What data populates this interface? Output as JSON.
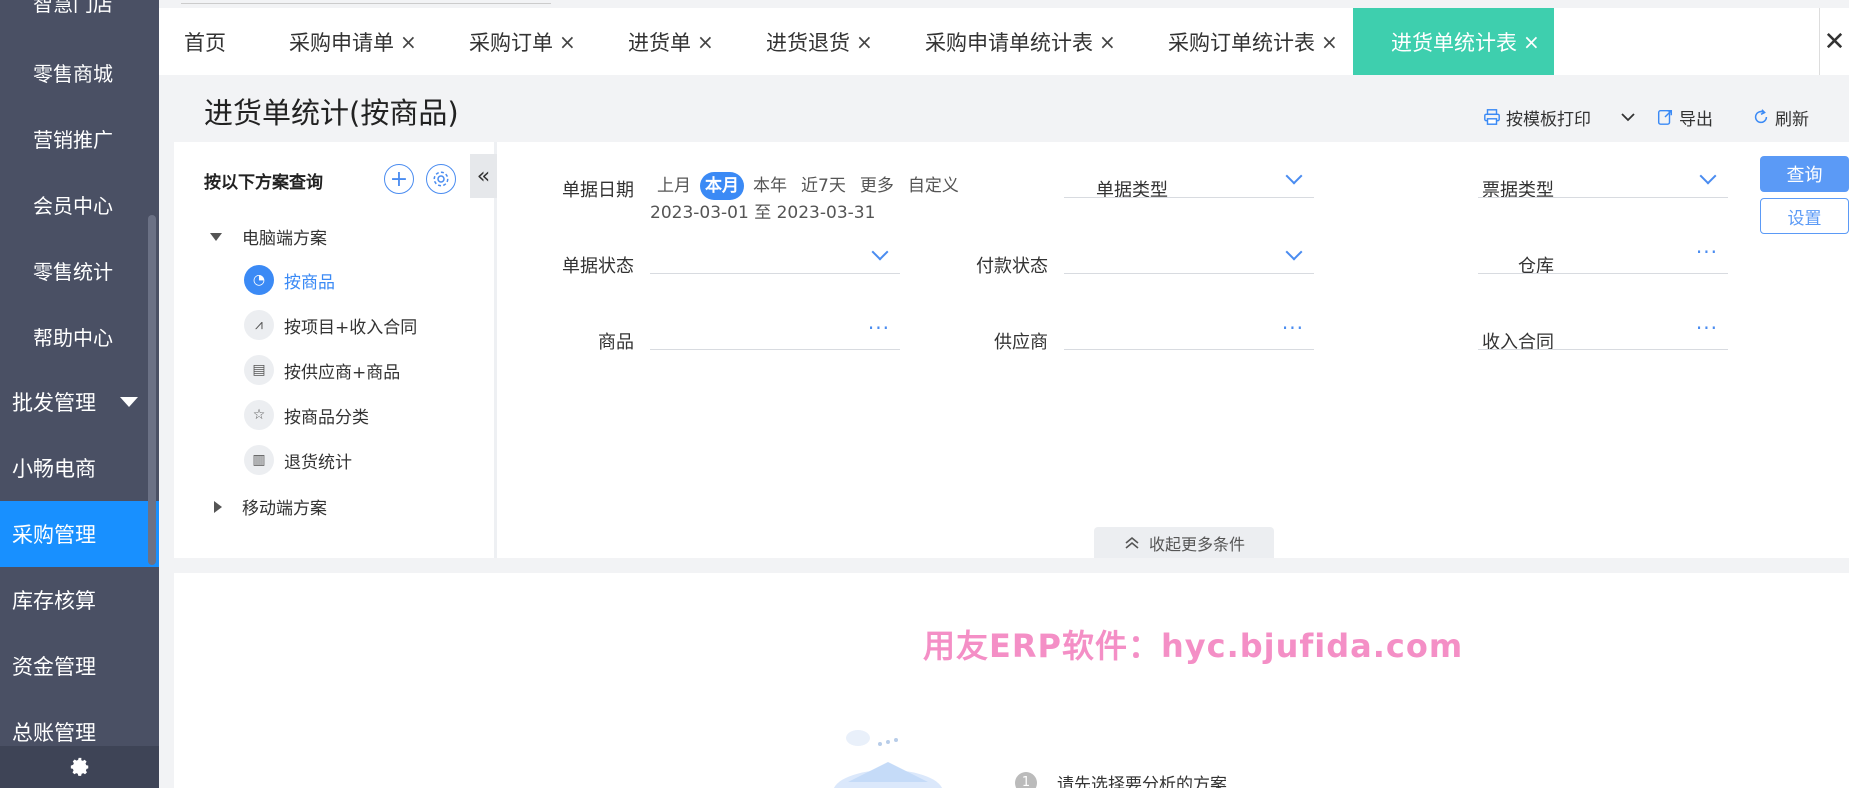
{
  "sidebar": {
    "top_partial": "智慧门店",
    "sub_items": [
      "零售商城",
      "营销推广",
      "会员中心",
      "零售统计",
      "帮助中心"
    ],
    "main_items": [
      {
        "label": "批发管理",
        "expand": true
      },
      {
        "label": "小畅电商"
      },
      {
        "label": "采购管理",
        "active": true
      },
      {
        "label": "库存核算"
      },
      {
        "label": "资金管理"
      },
      {
        "label": "总账管理"
      }
    ]
  },
  "tabs": {
    "home": "首页",
    "t1": "采购申请单",
    "t2": "采购订单",
    "t3": "进货单",
    "t4": "进货退货",
    "t5": "采购申请单统计表",
    "t6": "采购订单统计表",
    "t7": "进货单统计表",
    "close": "×",
    "close_all": "✕"
  },
  "header": {
    "title": "进货单统计(按商品)",
    "print": "按模板打印",
    "export": "导出",
    "refresh": "刷新"
  },
  "left_panel": {
    "title": "按以下方案查询",
    "pc_scheme": "电脑端方案",
    "leaves": [
      "按商品",
      "按项目+收入合同",
      "按供应商+商品",
      "按商品分类",
      "退货统计"
    ],
    "mobile_scheme": "移动端方案"
  },
  "filters": {
    "date_label": "单据日期",
    "date_pills": [
      "上月",
      "本月",
      "本年",
      "近7天",
      "更多",
      "自定义"
    ],
    "date_range": "2023-03-01 至 2023-03-31",
    "doc_type": "单据类型",
    "invoice_type": "票据类型",
    "doc_status": "单据状态",
    "pay_status": "付款状态",
    "warehouse": "仓库",
    "product": "商品",
    "supplier": "供应商",
    "income_contract": "收入合同",
    "more": "···"
  },
  "buttons": {
    "query": "查询",
    "settings": "设置",
    "collapse_more": "收起更多条件"
  },
  "result": {
    "watermark": "用友ERP软件：hyc.bjufida.com",
    "step_num": "1",
    "hint": "请先选择要分析的方案"
  },
  "colors": {
    "sidebar": "#4a5064",
    "active_tab": "#3ecfae",
    "primary": "#3b8af5",
    "watermark": "#f48fc6"
  }
}
